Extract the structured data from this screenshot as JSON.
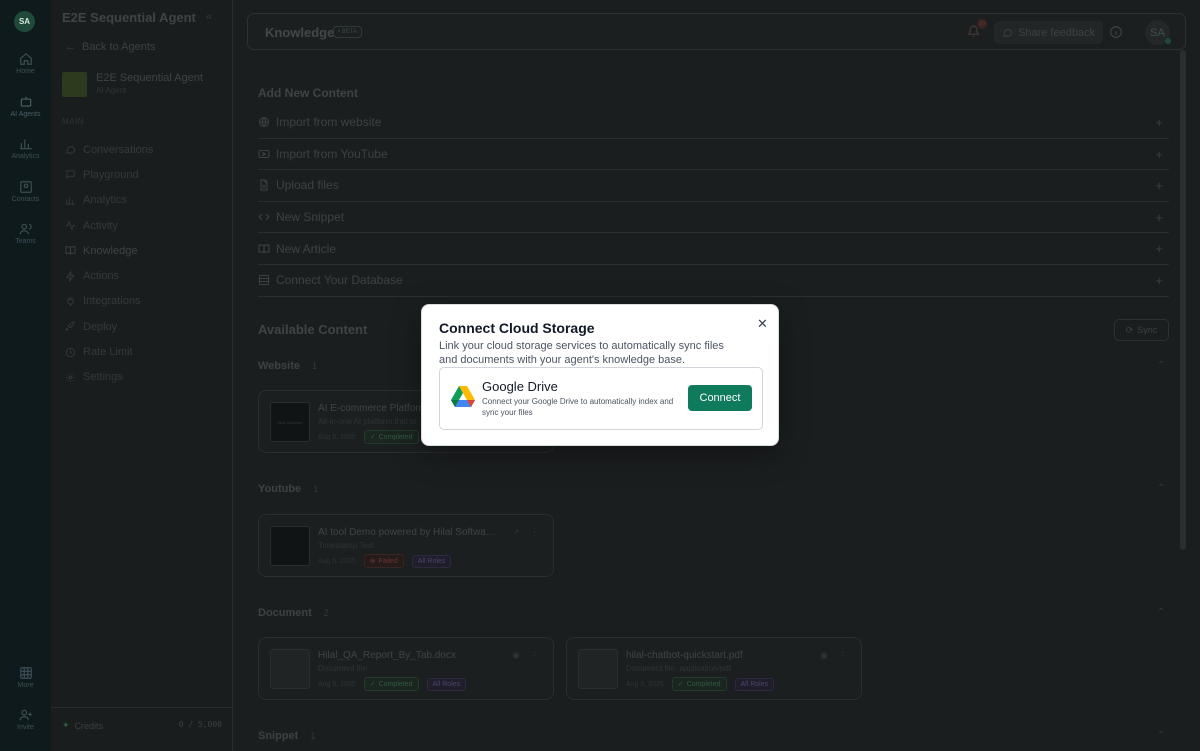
{
  "rail": {
    "avatar": "SA",
    "items": [
      {
        "label": "Home",
        "icon": "home-icon"
      },
      {
        "label": "AI Agents",
        "icon": "bot-icon"
      },
      {
        "label": "Analytics",
        "icon": "chart-icon"
      },
      {
        "label": "Contacts",
        "icon": "contacts-icon"
      },
      {
        "label": "Teams",
        "icon": "users-icon"
      }
    ],
    "bottom": [
      {
        "label": "More",
        "icon": "grid-icon"
      },
      {
        "label": "Invite",
        "icon": "user-plus-icon"
      }
    ]
  },
  "sidebar": {
    "title": "E2E Sequential Agent",
    "back": "Back to Agents",
    "agent_name": "E2E Sequential Agent",
    "agent_type": "AI Agent",
    "section": "MAIN",
    "nav": [
      "Conversations",
      "Playground",
      "Analytics",
      "Activity",
      "Knowledge",
      "Actions",
      "Integrations",
      "Deploy",
      "Rate Limit",
      "Settings"
    ],
    "credits_label": "Credits",
    "credits_value": "0 / 5,000"
  },
  "topbar": {
    "title": "Knowledge",
    "beta": "• BETA",
    "notif_count": "10",
    "feedback": "Share feedback",
    "avatar": "SA"
  },
  "add_content": {
    "heading": "Add New Content",
    "items": [
      "Import from website",
      "Import from YouTube",
      "Upload files",
      "New Snippet",
      "New Article",
      "Connect Your Database"
    ]
  },
  "available": {
    "heading": "Available Content",
    "sync": "Sync",
    "groups": {
      "website": {
        "label": "Website",
        "count": "1"
      },
      "youtube": {
        "label": "Youtube",
        "count": "1"
      },
      "document": {
        "label": "Document",
        "count": "2"
      },
      "snippet": {
        "label": "Snippet",
        "count": "1"
      }
    },
    "cards": {
      "website": {
        "title": "AI E-commerce Platform",
        "sub": "All-in-one AI platform that st",
        "date": "Aug 5, 2025",
        "status": "Completed",
        "thumb": "Hilal Software"
      },
      "youtube": {
        "title": "AI tool Demo powered by Hilal Software...",
        "sub": "Timestamp Text",
        "date": "Aug 5, 2025",
        "status": "Failed",
        "roles": "All Roles"
      },
      "doc1": {
        "title": "Hilal_QA_Report_By_Tab.docx",
        "sub": "Document file:",
        "date": "Aug 5, 2025",
        "status": "Completed",
        "roles": "All Roles"
      },
      "doc2": {
        "title": "hilal-chatbot-quickstart.pdf",
        "sub": "Document file: application/pdf",
        "date": "Aug 5, 2025",
        "status": "Completed",
        "roles": "All Roles"
      }
    }
  },
  "modal": {
    "title": "Connect Cloud Storage",
    "description": "Link your cloud storage services to automatically sync files and documents with your agent's knowledge base.",
    "provider_name": "Google Drive",
    "provider_desc": "Connect your Google Drive to automatically index and sync your files",
    "connect": "Connect",
    "colors": {
      "primary": "#0f7a5c"
    }
  }
}
